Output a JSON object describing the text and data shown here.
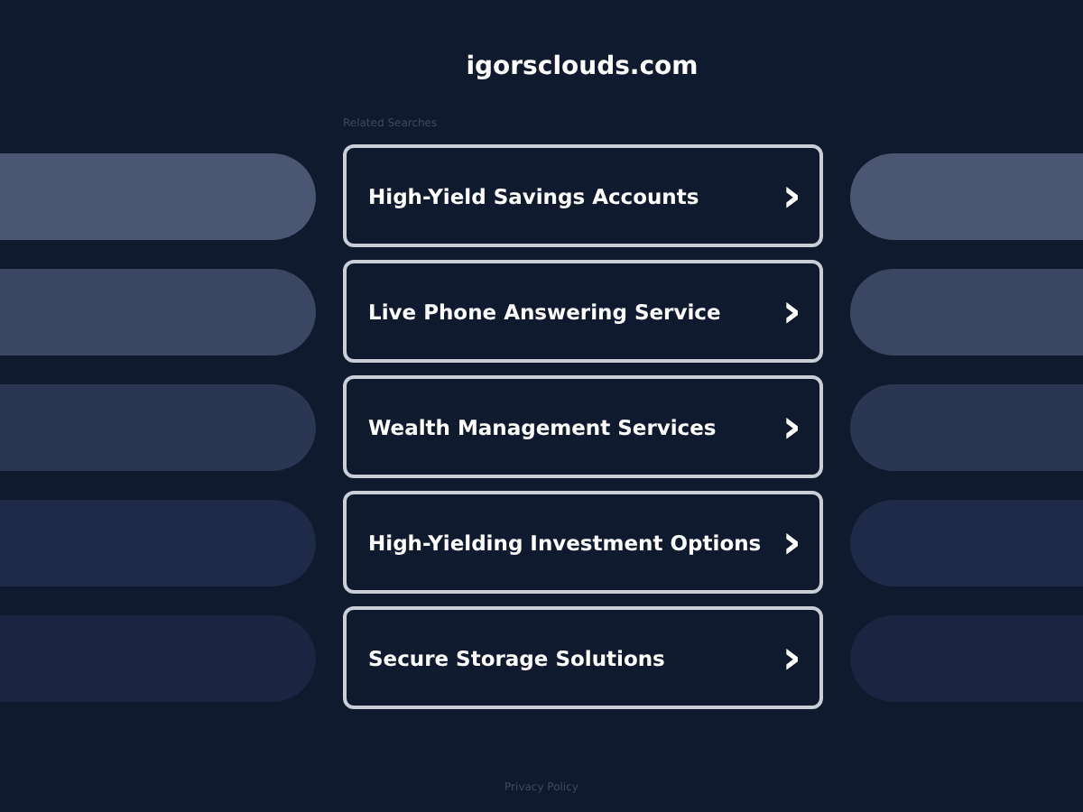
{
  "site_title": "igorsclouds.com",
  "section_label": "Related Searches",
  "links": [
    {
      "label": "High-Yield Savings Accounts",
      "arrow": "›"
    },
    {
      "label": "Live Phone Answering Service",
      "arrow": "›"
    },
    {
      "label": "Wealth Management Services",
      "arrow": "›"
    },
    {
      "label": "High-Yielding Investment Options",
      "arrow": "›"
    },
    {
      "label": "Secure Storage Solutions",
      "arrow": "›"
    }
  ],
  "footer_link": "Privacy Policy"
}
